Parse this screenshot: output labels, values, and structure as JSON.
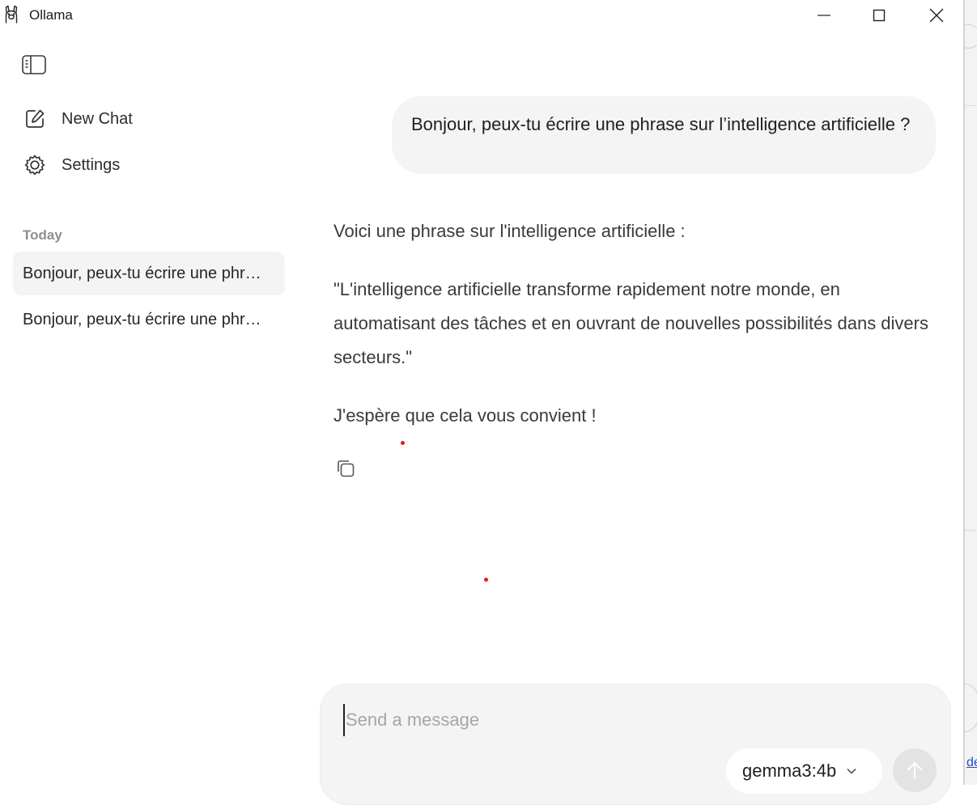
{
  "window": {
    "title": "Ollama"
  },
  "sidebar": {
    "nav": [
      {
        "label": "New Chat",
        "icon": "new-chat-icon"
      },
      {
        "label": "Settings",
        "icon": "gear-icon"
      }
    ],
    "section_label": "Today",
    "history": [
      {
        "label": "Bonjour, peux-tu écrire une phr…",
        "active": true
      },
      {
        "label": "Bonjour, peux-tu écrire une phr…",
        "active": false
      }
    ]
  },
  "chat": {
    "user_message": "Bonjour, peux-tu écrire une phrase sur l’intelligence artificielle ?",
    "assistant": {
      "p1": "Voici une phrase sur l'intelligence artificielle :",
      "p2": "\"L'intelligence artificielle transforme rapidement notre monde, en automatisant des tâches et en ouvrant de nouvelles possibilités dans divers secteurs.\"",
      "p3": "J'espère que cela vous convient !"
    }
  },
  "composer": {
    "placeholder": "Send a message",
    "value": "",
    "model": "gemma3:4b"
  },
  "background_window": {
    "fragment": "de"
  },
  "colors": {
    "bubble_bg": "#f4f4f4",
    "composer_bg": "#f4f4f4",
    "muted_text": "#8f8f8f",
    "send_button_bg": "#e3e3e3"
  }
}
